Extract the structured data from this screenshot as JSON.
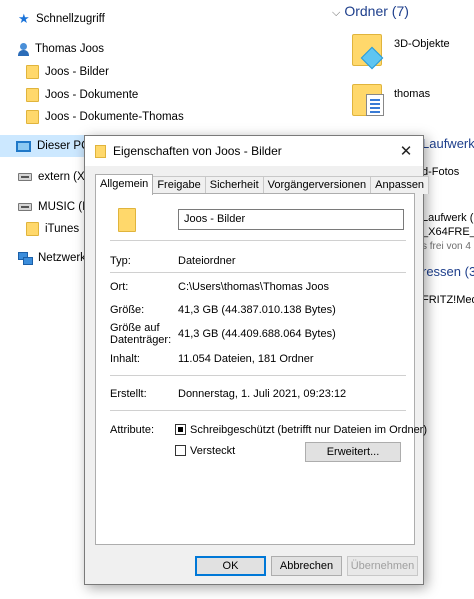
{
  "nav": {
    "items": [
      {
        "label": "Schnellzugriff"
      },
      {
        "label": "Thomas Joos"
      },
      {
        "label": "Joos - Bilder"
      },
      {
        "label": "Joos - Dokumente"
      },
      {
        "label": "Joos - Dokumente-Thomas"
      },
      {
        "label": "Dieser PC"
      },
      {
        "label": "extern (X:"
      },
      {
        "label": "MUSIC (I:)"
      },
      {
        "label": "iTunes"
      },
      {
        "label": "Netzwerk"
      }
    ]
  },
  "content": {
    "group_header": "Ordner (7)",
    "items": [
      {
        "label": "3D-Objekte"
      },
      {
        "label": "thomas"
      }
    ],
    "fragments": [
      "Laufwerk",
      "d-Fotos",
      "Laufwerk (I",
      "_X64FRE_D",
      "s frei von 4",
      "ressen (3",
      "FRITZ!Medi"
    ]
  },
  "dialog": {
    "title": "Eigenschaften von Joos - Bilder",
    "close_symbol": "✕",
    "tabs": [
      {
        "label": "Allgemein"
      },
      {
        "label": "Freigabe"
      },
      {
        "label": "Sicherheit"
      },
      {
        "label": "Vorgängerversionen"
      },
      {
        "label": "Anpassen"
      }
    ],
    "name_value": "Joos - Bilder",
    "rows": {
      "typ_label": "Typ:",
      "typ_value": "Dateiordner",
      "ort_label": "Ort:",
      "ort_value": "C:\\Users\\thomas\\Thomas Joos",
      "groesse_label": "Größe:",
      "groesse_value": "41,3 GB (44.387.010.138 Bytes)",
      "datentraeger_label_1": "Größe auf",
      "datentraeger_label_2": "Datenträger:",
      "datentraeger_value": "41,3 GB (44.409.688.064 Bytes)",
      "inhalt_label": "Inhalt:",
      "inhalt_value": "11.054 Dateien, 181 Ordner",
      "erstellt_label": "Erstellt:",
      "erstellt_value": "Donnerstag, 1. Juli 2021, 09:23:12",
      "attribute_label": "Attribute:"
    },
    "attributes": {
      "readonly_label": "Schreibgeschützt (betrifft nur Dateien im Ordner)",
      "readonly_state": "indeterminate",
      "hidden_label": "Versteckt",
      "hidden_state": "unchecked",
      "advanced_button": "Erweitert..."
    },
    "buttons": {
      "ok": "OK",
      "cancel": "Abbrechen",
      "apply": "Übernehmen"
    }
  }
}
